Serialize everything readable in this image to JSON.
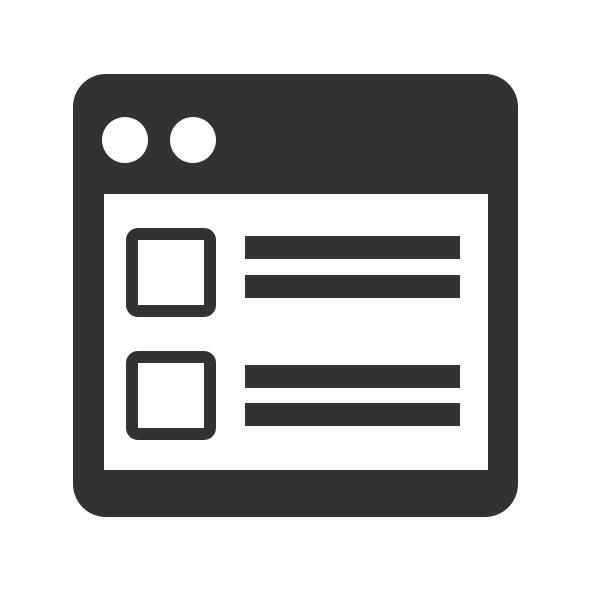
{
  "icon": {
    "name": "browser-window-checklist-icon",
    "fill_color": "#333233",
    "background_color": "#ffffff",
    "window_dots": 2,
    "list_items": 2
  }
}
